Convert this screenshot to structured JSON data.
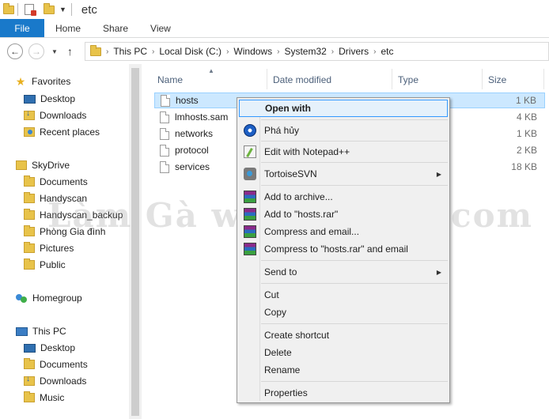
{
  "window": {
    "title": "etc"
  },
  "ribbon": {
    "file": "File",
    "tabs": [
      "Home",
      "Share",
      "View"
    ]
  },
  "address": {
    "crumbs": [
      "This PC",
      "Local Disk (C:)",
      "Windows",
      "System32",
      "Drivers",
      "etc"
    ]
  },
  "nav": {
    "favorites": {
      "label": "Favorites",
      "items": [
        "Desktop",
        "Downloads",
        "Recent places"
      ]
    },
    "skydrive": {
      "label": "SkyDrive",
      "items": [
        "Documents",
        "Handyscan",
        "Handyscan_backup",
        "Phòng Gia đình",
        "Pictures",
        "Public"
      ]
    },
    "homegroup": {
      "label": "Homegroup"
    },
    "thispc": {
      "label": "This PC",
      "items": [
        "Desktop",
        "Documents",
        "Downloads",
        "Music"
      ]
    }
  },
  "columns": {
    "name": "Name",
    "date": "Date modified",
    "type": "Type",
    "size": "Size"
  },
  "files": [
    {
      "name": "hosts",
      "size": "1 KB"
    },
    {
      "name": "lmhosts.sam",
      "size": "4 KB"
    },
    {
      "name": "networks",
      "size": "1 KB"
    },
    {
      "name": "protocol",
      "size": "2 KB"
    },
    {
      "name": "services",
      "size": "18 KB"
    }
  ],
  "context_menu": {
    "open_with": "Open with",
    "pha_huy": "Phá hủy",
    "notepadpp": "Edit with Notepad++",
    "tortoise": "TortoiseSVN",
    "add_archive": "Add to archive...",
    "add_rar": "Add to \"hosts.rar\"",
    "compress_email": "Compress and email...",
    "compress_rar_email": "Compress to \"hosts.rar\" and email",
    "send_to": "Send to",
    "cut": "Cut",
    "copy": "Copy",
    "create_shortcut": "Create shortcut",
    "delete": "Delete",
    "rename": "Rename",
    "properties": "Properties"
  },
  "watermark": "Làm Gà  www.e10mt.com"
}
